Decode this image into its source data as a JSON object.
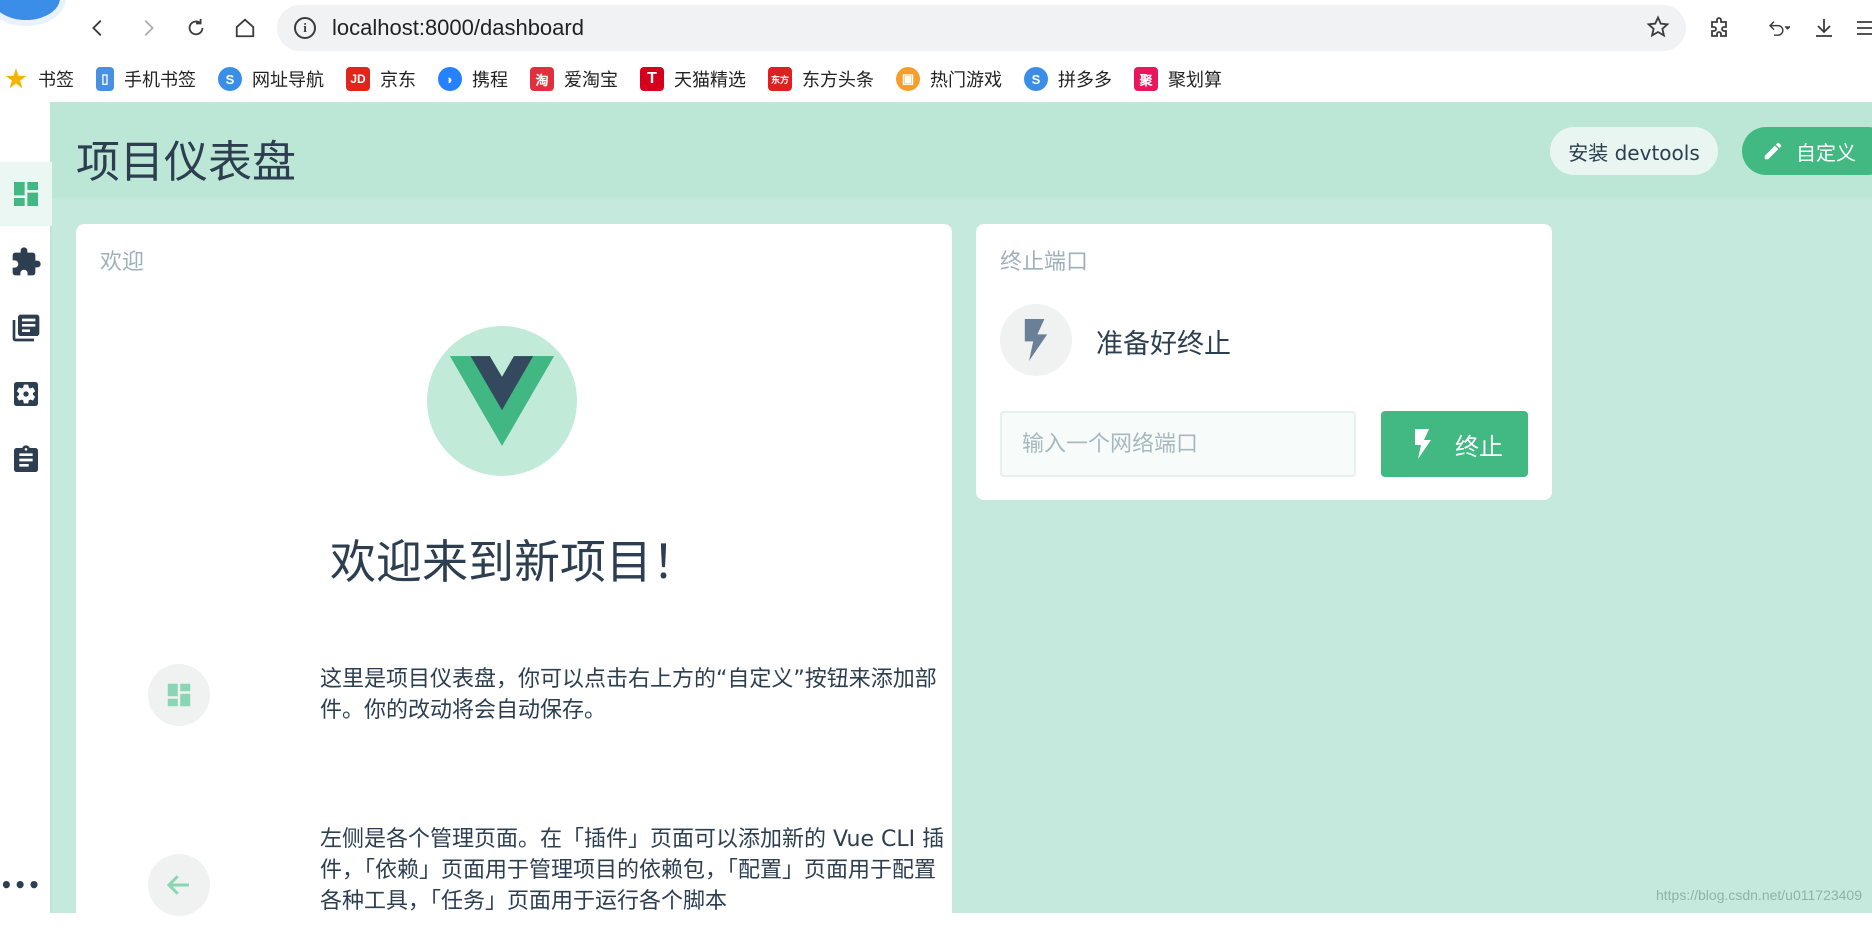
{
  "browser": {
    "url": "localhost:8000/dashboard",
    "bookmarks": [
      {
        "label": "书签",
        "icon": "star-icon",
        "color": "#f4b400"
      },
      {
        "label": "手机书签",
        "icon": "phone-bookmark-icon",
        "color": "#4a90e2"
      },
      {
        "label": "网址导航",
        "icon": "nav-icon",
        "color": "#3b8ee8"
      },
      {
        "label": "京东",
        "icon": "jd-icon",
        "color": "#e1251b"
      },
      {
        "label": "携程",
        "icon": "ctrip-icon",
        "color": "#2681ff"
      },
      {
        "label": "爱淘宝",
        "icon": "taobao-icon",
        "color": "#e0303d"
      },
      {
        "label": "天猫精选",
        "icon": "tmall-icon",
        "color": "#d6001c"
      },
      {
        "label": "东方头条",
        "icon": "dongfang-icon",
        "color": "#e02020"
      },
      {
        "label": "热门游戏",
        "icon": "games-icon",
        "color": "#f59e2c"
      },
      {
        "label": "拼多多",
        "icon": "pinduoduo-icon",
        "color": "#3b8ee8"
      },
      {
        "label": "聚划算",
        "icon": "juhuasuan-icon",
        "color": "#e8175d"
      }
    ]
  },
  "header": {
    "title": "项目仪表盘",
    "devtools_label": "安装 devtools",
    "customize_label": "自定义"
  },
  "welcome": {
    "card_title": "欢迎",
    "heading": "欢迎来到新项目！",
    "tip1": "这里是项目仪表盘，你可以点击右上方的“自定义”按钮来添加部件。你的改动将会自动保存。",
    "tip2": "左侧是各个管理页面。在「插件」页面可以添加新的 Vue CLI 插件，「依赖」页面用于管理项目的依赖包，「配置」页面用于配置各种工具，「任务」页面用于运行各个脚本"
  },
  "kill_port": {
    "card_title": "终止端口",
    "status": "准备好终止",
    "placeholder": "输入一个网络端口",
    "button_label": "终止"
  },
  "watermark": "https://blog.csdn.net/u011723409",
  "colors": {
    "accent": "#42b983",
    "background": "#c6e9dd",
    "header": "#bce6d6"
  }
}
